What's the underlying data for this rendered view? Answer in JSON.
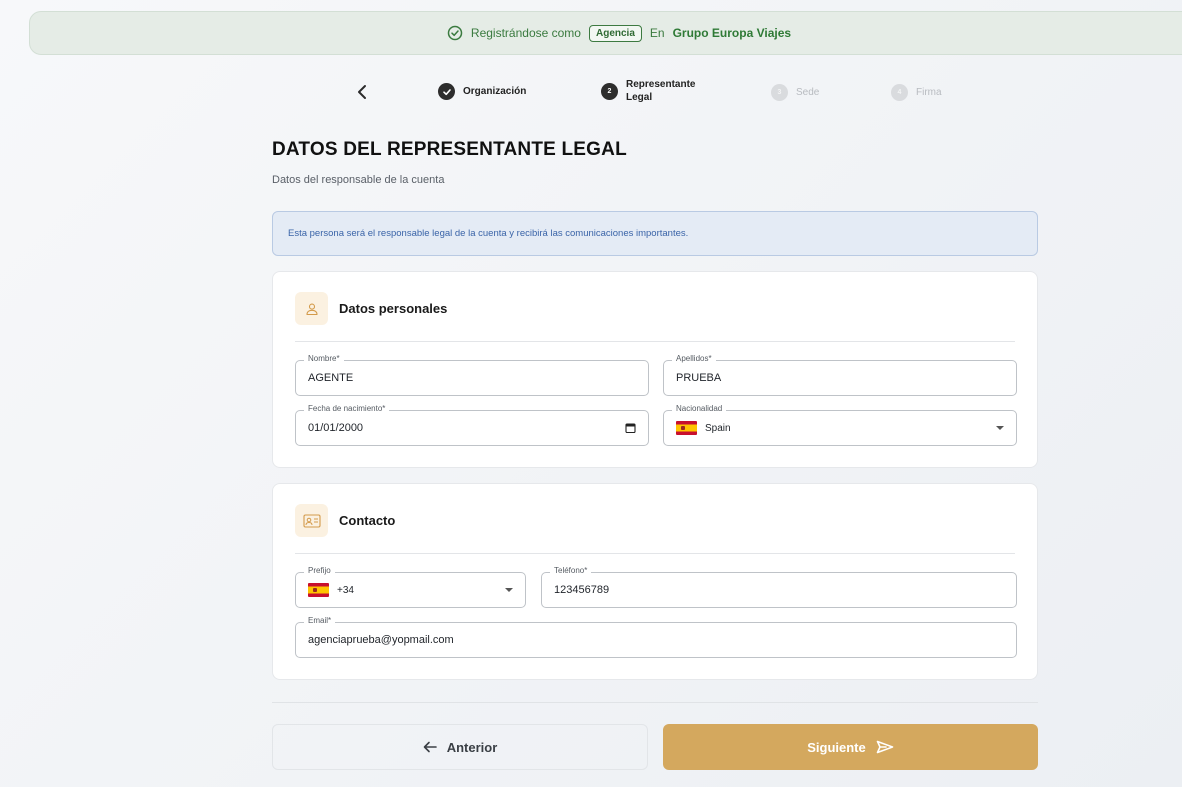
{
  "banner": {
    "prefix": "Registrándose como",
    "role": "Agencia",
    "connector": "En",
    "organization": "Grupo Europa Viajes"
  },
  "stepper": {
    "steps": [
      {
        "number": "1",
        "label": "Organización",
        "state": "done"
      },
      {
        "number": "2",
        "label": "Representante Legal",
        "state": "active"
      },
      {
        "number": "3",
        "label": "Sede",
        "state": "pending"
      },
      {
        "number": "4",
        "label": "Firma",
        "state": "pending"
      }
    ]
  },
  "page": {
    "title": "DATOS DEL REPRESENTANTE LEGAL",
    "subtitle": "Datos del responsable de la cuenta",
    "info": "Esta persona será el responsable legal de la cuenta y recibirá las comunicaciones importantes."
  },
  "personal": {
    "title": "Datos personales",
    "icon": "user-icon",
    "nombre": {
      "label": "Nombre*",
      "value": "AGENTE"
    },
    "apellidos": {
      "label": "Apellidos*",
      "value": "PRUEBA"
    },
    "fecha": {
      "label": "Fecha de nacimiento*",
      "value": "01/01/2000"
    },
    "nacionalidad": {
      "label": "Nacionalidad",
      "value": "Spain"
    }
  },
  "contacto": {
    "title": "Contacto",
    "icon": "id-card-icon",
    "prefijo": {
      "label": "Prefijo",
      "value": "+34"
    },
    "telefono": {
      "label": "Teléfono*",
      "value": "123456789"
    },
    "email": {
      "label": "Email*",
      "value": "agenciaprueba@yopmail.com"
    }
  },
  "actions": {
    "previous": "Anterior",
    "next": "Siguiente"
  },
  "colors": {
    "accent": "#d4a85e",
    "success": "#2f7a36",
    "info_text": "#3a64a8"
  }
}
